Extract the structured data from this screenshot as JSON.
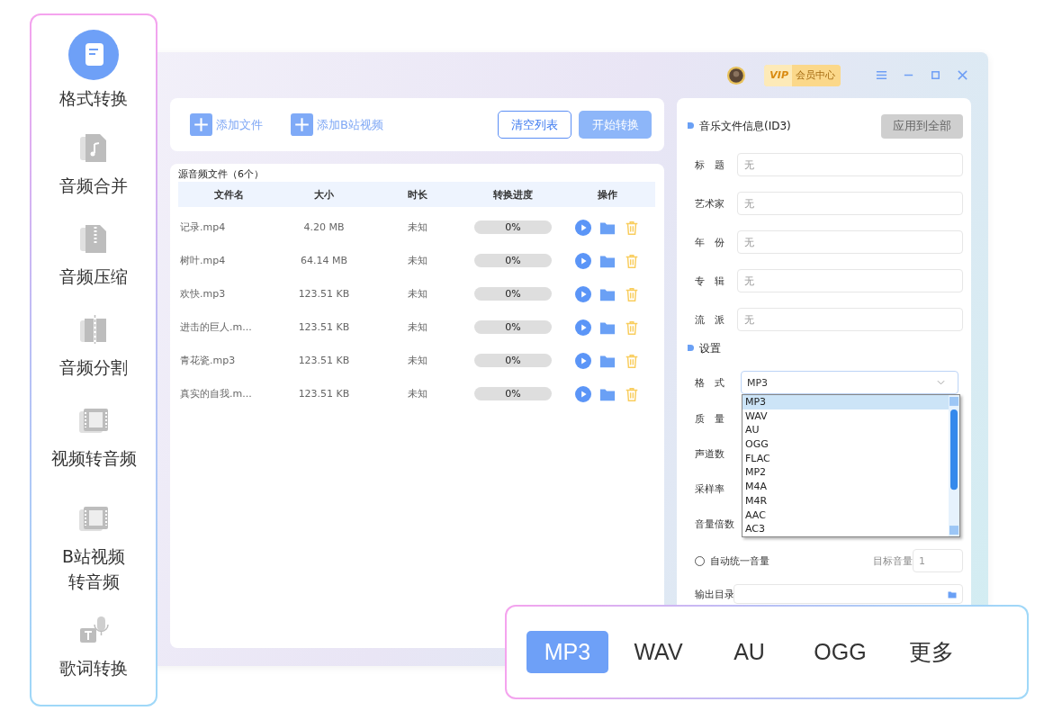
{
  "sidebar": {
    "items": [
      {
        "label": "格式转换",
        "selected": true
      },
      {
        "label": "音频合并",
        "selected": false
      },
      {
        "label": "音频压缩",
        "selected": false
      },
      {
        "label": "音频分割",
        "selected": false
      },
      {
        "label": "视频转音频",
        "selected": false
      },
      {
        "label": "B站视频转音频",
        "selected": false
      },
      {
        "label": "歌词转换",
        "selected": false
      }
    ]
  },
  "window": {
    "vip_mark": "VIP",
    "vip_label": "会员中心"
  },
  "toolbar": {
    "add_file": "添加文件",
    "add_bilibili": "添加B站视频",
    "clear": "清空列表",
    "start": "开始转换"
  },
  "file_list": {
    "title": "源音频文件（6个）",
    "columns": [
      "文件名",
      "大小",
      "时长",
      "转换进度",
      "操作"
    ],
    "rows": [
      {
        "name": "记录.mp4",
        "size": "4.20 MB",
        "duration": "未知",
        "progress": "0%",
        "level": 0
      },
      {
        "name": "树叶.mp4",
        "size": "64.14 MB",
        "duration": "未知",
        "progress": "0%",
        "level": 0
      },
      {
        "name": "欢快.mp3",
        "size": "123.51 KB",
        "duration": "未知",
        "progress": "0%",
        "level": 0
      },
      {
        "name": "进击的巨人.m...",
        "size": "123.51 KB",
        "duration": "未知",
        "progress": "0%",
        "level": 0
      },
      {
        "name": "青花瓷.mp3",
        "size": "123.51 KB",
        "duration": "未知",
        "progress": "0%",
        "level": 0
      },
      {
        "name": "真实的自我.m...",
        "size": "123.51 KB",
        "duration": "未知",
        "progress": "0%",
        "level": 0
      }
    ]
  },
  "id3_panel": {
    "title": "音乐文件信息(ID3)",
    "apply_button": "应用到全部",
    "fields": [
      {
        "label": "标　题",
        "placeholder": "无"
      },
      {
        "label": "艺术家",
        "placeholder": "无"
      },
      {
        "label": "年　份",
        "placeholder": "无"
      },
      {
        "label": "专　辑",
        "placeholder": "无"
      },
      {
        "label": "流　派",
        "placeholder": "无"
      }
    ]
  },
  "settings": {
    "title": "设置",
    "format": {
      "label": "格　式",
      "value": "MP3",
      "expanded": true,
      "options": [
        {
          "label": "MP3",
          "selected": true
        },
        {
          "label": "WAV",
          "selected": false
        },
        {
          "label": "AU",
          "selected": false
        },
        {
          "label": "OGG",
          "selected": false
        },
        {
          "label": "FLAC",
          "selected": false
        },
        {
          "label": "MP2",
          "selected": false
        },
        {
          "label": "M4A",
          "selected": false
        },
        {
          "label": "M4R",
          "selected": false
        },
        {
          "label": "AAC",
          "selected": false
        },
        {
          "label": "AC3",
          "selected": false
        }
      ]
    },
    "row_labels": [
      "质　量",
      "声道数",
      "采样率",
      "音量倍数"
    ],
    "auto_volume": {
      "label": "自动统一音量",
      "checked": false
    },
    "target_volume": {
      "label": "目标音量",
      "value": "1"
    },
    "output_dir": {
      "label": "输出目录"
    }
  },
  "format_bar": {
    "items": [
      {
        "label": "MP3",
        "selected": true
      },
      {
        "label": "WAV",
        "selected": false
      },
      {
        "label": "AU",
        "selected": false
      },
      {
        "label": "OGG",
        "selected": false
      },
      {
        "label": "更多",
        "selected": false
      }
    ]
  }
}
